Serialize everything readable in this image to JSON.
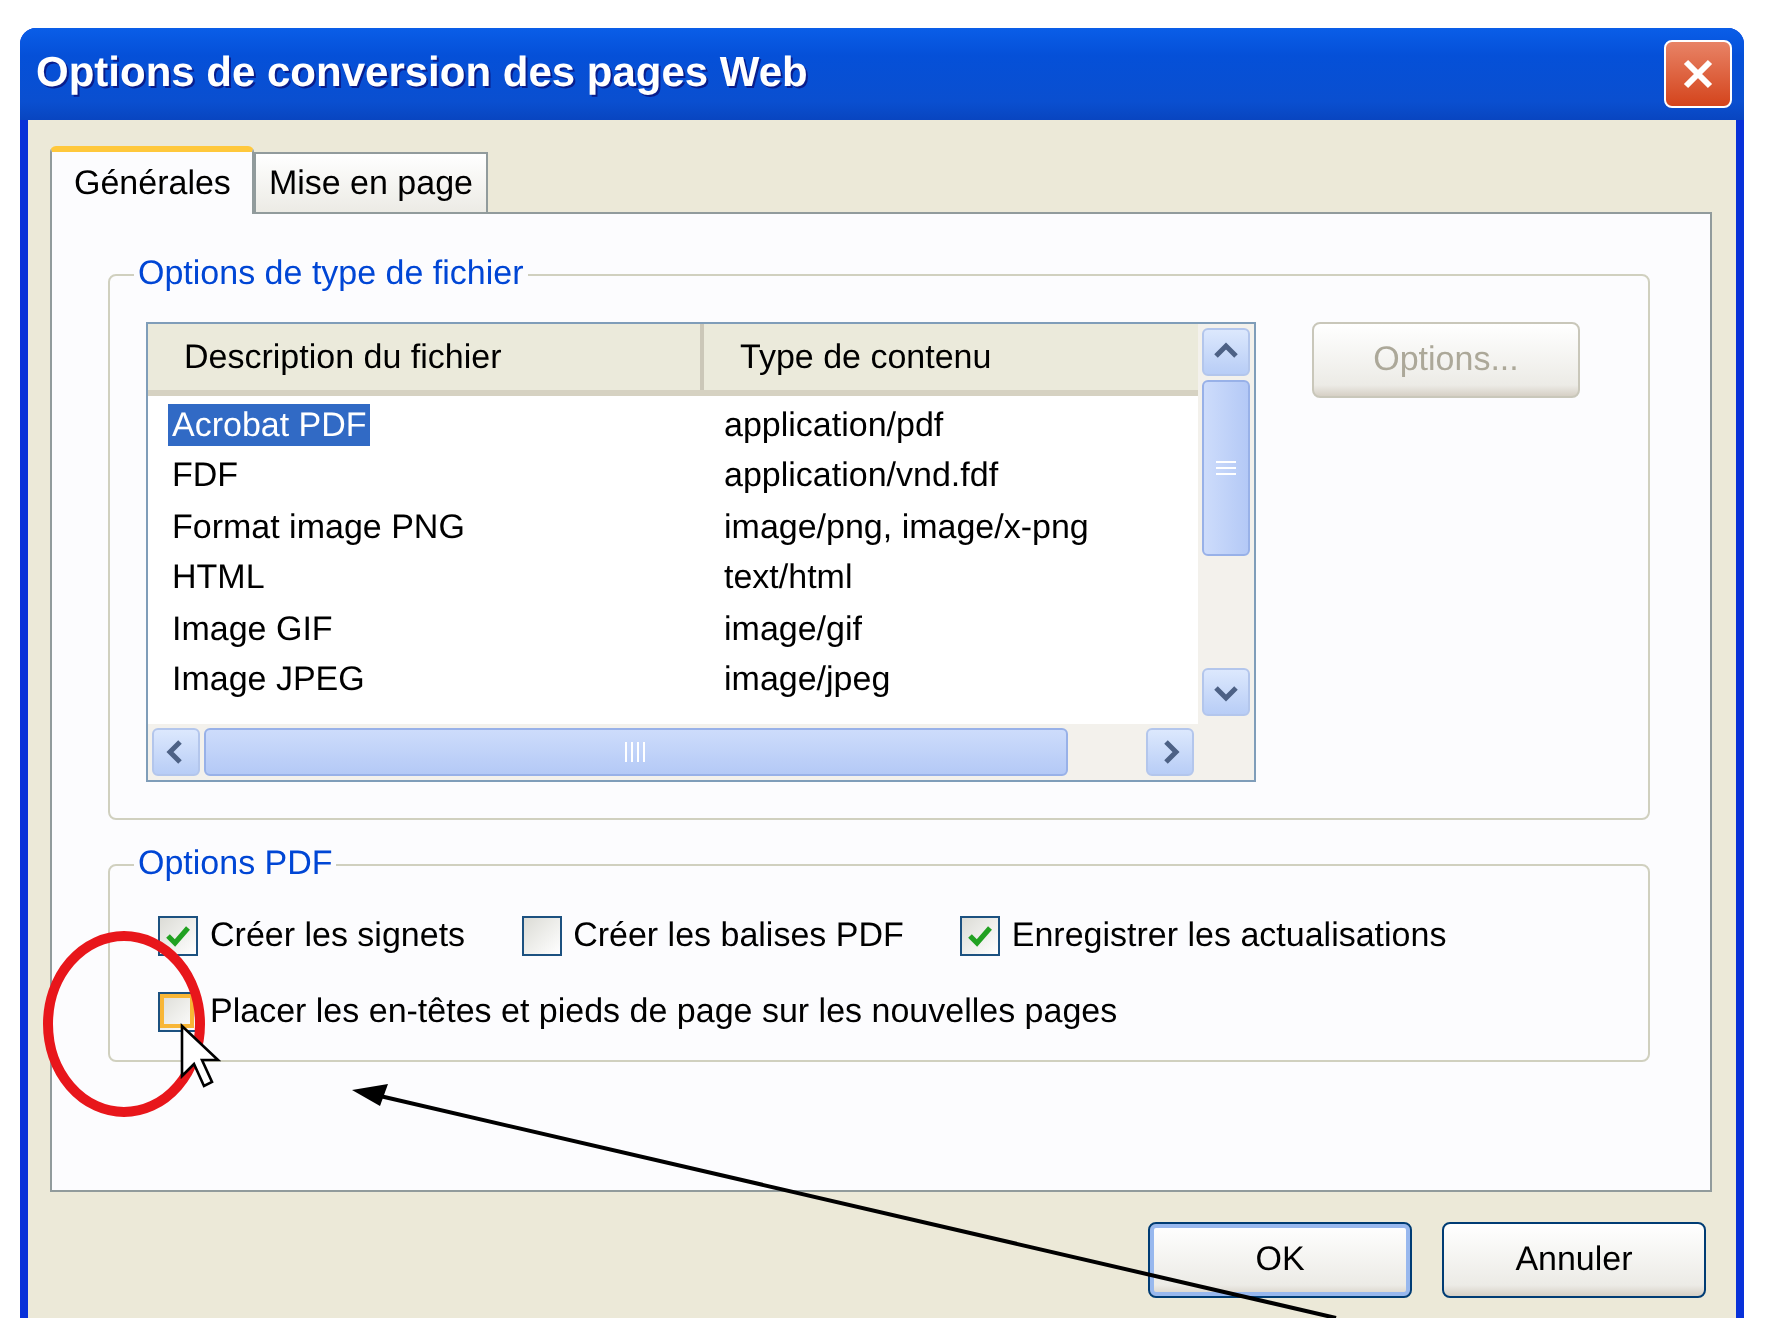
{
  "window": {
    "title": "Options de conversion des pages Web"
  },
  "tabs": [
    {
      "label": "Générales",
      "selected": true
    },
    {
      "label": "Mise en page",
      "selected": false
    }
  ],
  "file_type_group": {
    "title": "Options de type de fichier",
    "columns": [
      "Description du fichier",
      "Type de contenu"
    ],
    "rows": [
      {
        "description": "Acrobat PDF",
        "type": "application/pdf",
        "selected": true
      },
      {
        "description": "FDF",
        "type": "application/vnd.fdf",
        "selected": false
      },
      {
        "description": "Format image PNG",
        "type": "image/png, image/x-png",
        "selected": false
      },
      {
        "description": "HTML",
        "type": "text/html",
        "selected": false
      },
      {
        "description": "Image GIF",
        "type": "image/gif",
        "selected": false
      },
      {
        "description": "Image JPEG",
        "type": "image/jpeg",
        "selected": false
      }
    ],
    "options_button": {
      "label": "Options...",
      "disabled": true
    }
  },
  "pdf_group": {
    "title": "Options PDF",
    "checkboxes": [
      {
        "label": "Créer les signets",
        "checked": true,
        "hovered": false
      },
      {
        "label": "Créer les balises PDF",
        "checked": false,
        "hovered": false
      },
      {
        "label": "Enregistrer les actualisations",
        "checked": true,
        "hovered": false
      },
      {
        "label": "Placer les en-têtes et pieds de page sur les nouvelles pages",
        "checked": false,
        "hovered": true
      }
    ]
  },
  "buttons": [
    {
      "label": "OK",
      "default": true
    },
    {
      "label": "Annuler",
      "default": false
    }
  ]
}
